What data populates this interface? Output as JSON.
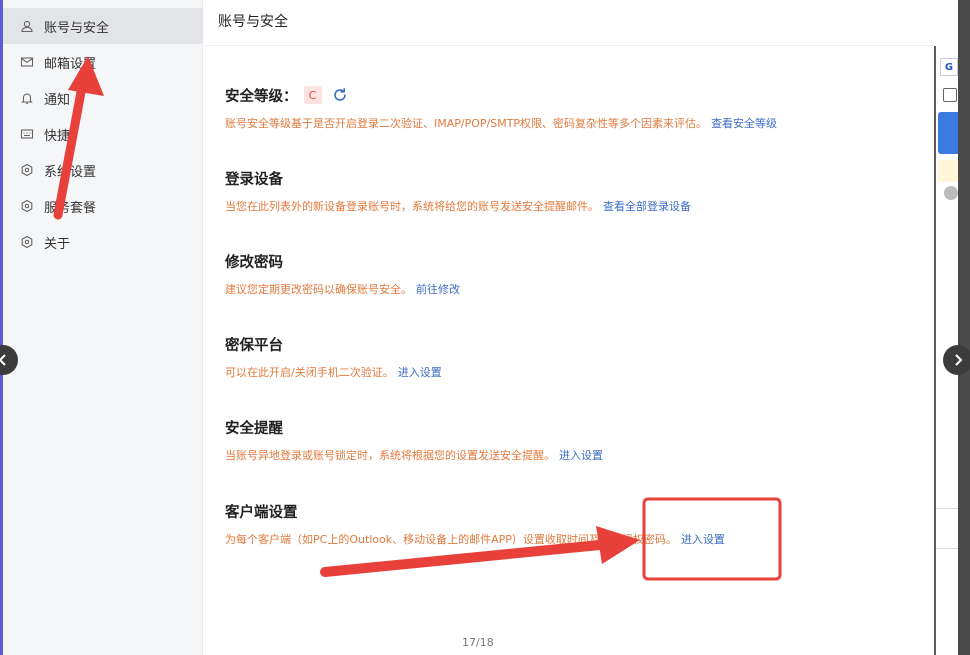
{
  "sidebar": {
    "items": [
      {
        "label": "账号与安全",
        "icon": "user-icon",
        "active": true
      },
      {
        "label": "邮箱设置",
        "icon": "mail-icon"
      },
      {
        "label": "通知",
        "icon": "bell-icon"
      },
      {
        "label": "快捷",
        "icon": "keyboard-icon"
      },
      {
        "label": "系统设置",
        "icon": "hexagon-settings-icon"
      },
      {
        "label": "服务套餐",
        "icon": "hexagon-settings-icon"
      },
      {
        "label": "关于",
        "icon": "hexagon-settings-icon"
      }
    ]
  },
  "header": {
    "title": "账号与安全"
  },
  "sections": {
    "security_level": {
      "title": "安全等级：",
      "level": "C",
      "desc": "账号安全等级基于是否开启登录二次验证、IMAP/POP/SMTP权限、密码复杂性等多个因素来评估。",
      "link": "查看安全等级"
    },
    "login_devices": {
      "title": "登录设备",
      "desc": "当您在此列表外的新设备登录账号时，系统将给您的账号发送安全提醒邮件。",
      "link": "查看全部登录设备"
    },
    "change_password": {
      "title": "修改密码",
      "desc": "建议您定期更改密码以确保账号安全。",
      "link": "前往修改"
    },
    "security_platform": {
      "title": "密保平台",
      "desc": "可以在此开启/关闭手机二次验证。",
      "link": "进入设置"
    },
    "security_alert": {
      "title": "安全提醒",
      "desc": "当账号异地登录或账号锁定时，系统将根据您的设置发送安全提醒。",
      "link": "进入设置"
    },
    "client_settings": {
      "title": "客户端设置",
      "desc": "为每个客户端（如PC上的Outlook、移动设备上的邮件APP）设置收取时间及独立授权密码。",
      "link": "进入设置"
    }
  },
  "pagination": {
    "text": "17/18"
  },
  "colors": {
    "accent_link": "#3d6cc4",
    "desc_text": "#e07a3e",
    "annotation_red": "#e8403a"
  }
}
